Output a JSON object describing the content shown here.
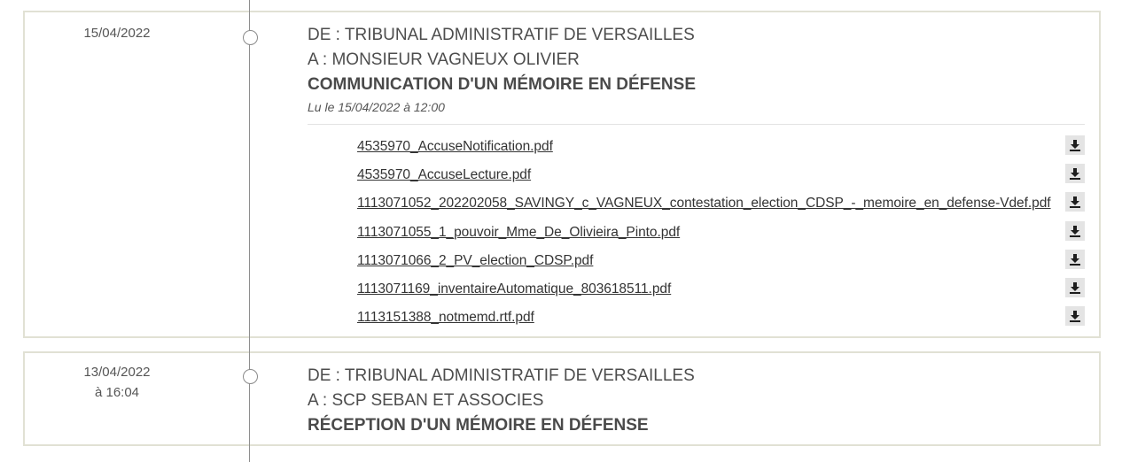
{
  "entries": [
    {
      "date": "15/04/2022",
      "from": "DE : TRIBUNAL ADMINISTRATIF DE VERSAILLES",
      "to": "A : MONSIEUR VAGNEUX OLIVIER",
      "subject": "COMMUNICATION D'UN MÉMOIRE EN DÉFENSE",
      "read_status": "Lu le 15/04/2022 à 12:00",
      "files": [
        "4535970_AccuseNotification.pdf",
        "4535970_AccuseLecture.pdf",
        "1113071052_202202058_SAVINGY_c_VAGNEUX_contestation_election_CDSP_-_memoire_en_defense-Vdef.pdf",
        "1113071055_1_pouvoir_Mme_De_Olivieira_Pinto.pdf",
        "1113071066_2_PV_election_CDSP.pdf",
        "1113071169_inventaireAutomatique_803618511.pdf",
        "1113151388_notmemd.rtf.pdf"
      ],
      "download_icon": "download-icon"
    },
    {
      "date": "13/04/2022",
      "time": "à 16:04",
      "from": "DE : TRIBUNAL ADMINISTRATIF DE VERSAILLES",
      "to": "A : SCP SEBAN ET ASSOCIES",
      "subject": "RÉCEPTION D'UN MÉMOIRE EN DÉFENSE"
    }
  ],
  "colors": {
    "border": "#e1e1d4",
    "timeline": "#8e8e8e",
    "download_bg": "#e4e4e4",
    "text": "#4a4a4a"
  }
}
